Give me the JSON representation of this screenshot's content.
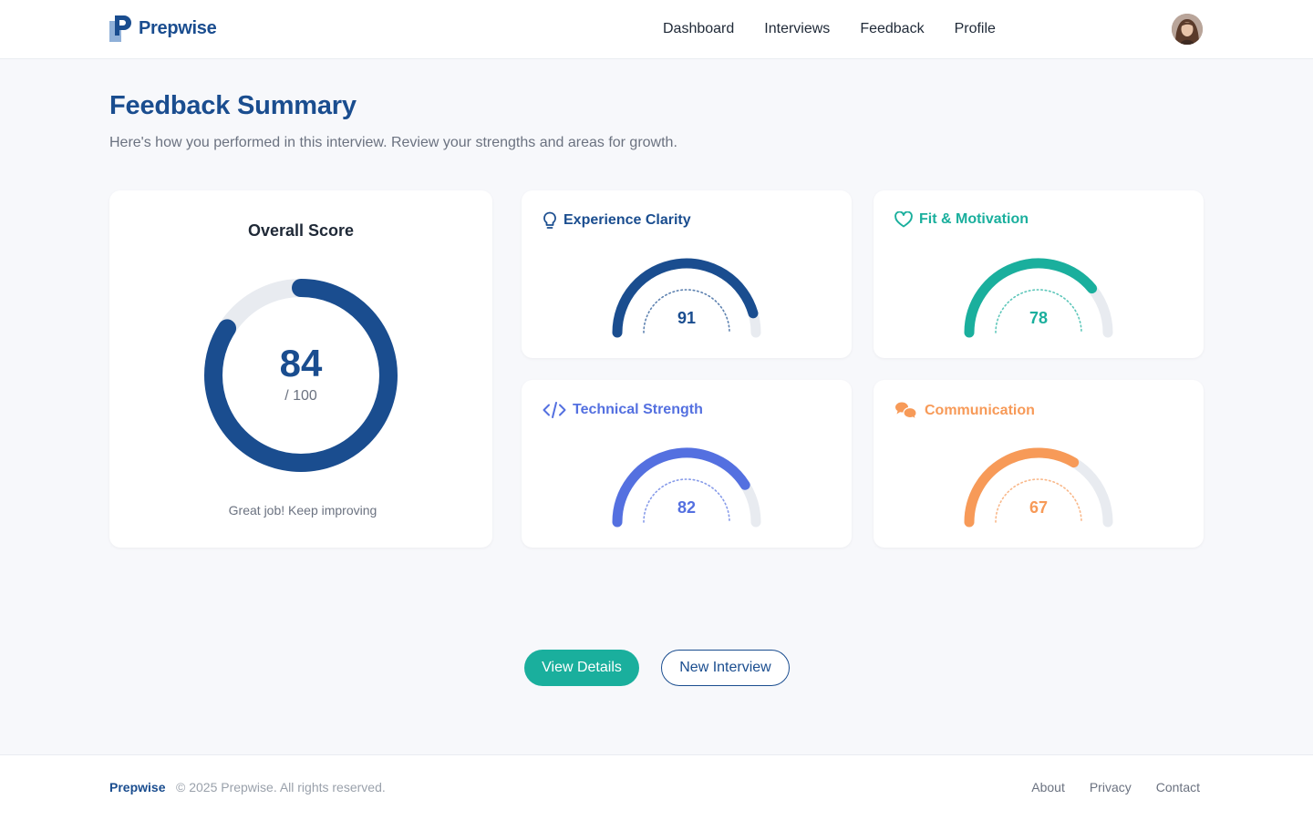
{
  "brand": {
    "name": "Prepwise"
  },
  "nav": {
    "items": [
      {
        "label": "Dashboard"
      },
      {
        "label": "Interviews"
      },
      {
        "label": "Feedback"
      },
      {
        "label": "Profile"
      }
    ]
  },
  "page": {
    "title": "Feedback Summary",
    "subtitle": "Here's how you performed in this interview. Review your strengths and areas for growth."
  },
  "overall": {
    "title": "Overall Score",
    "score": "84",
    "max": "/ 100",
    "caption": "Great job! Keep improving",
    "color": "#1a4d8f",
    "track_color": "#e8ebf0",
    "fraction": 0.84
  },
  "metrics": [
    {
      "label": "Experience Clarity",
      "value": "91",
      "fraction": 0.91,
      "color": "#1a4d8f",
      "icon": "lightbulb-icon"
    },
    {
      "label": "Fit & Motivation",
      "value": "78",
      "fraction": 0.78,
      "color": "#1aaf9d",
      "icon": "heart-icon"
    },
    {
      "label": "Technical Strength",
      "value": "82",
      "fraction": 0.82,
      "color": "#5470e0",
      "icon": "code-icon"
    },
    {
      "label": "Communication",
      "value": "67",
      "fraction": 0.67,
      "color": "#f79a58",
      "icon": "chat-bubbles-icon"
    }
  ],
  "actions": {
    "view_details": "View Details",
    "new_interview": "New Interview"
  },
  "footer": {
    "brand": "Prepwise",
    "copyright": "© 2025 Prepwise. All rights reserved.",
    "links": [
      {
        "label": "About"
      },
      {
        "label": "Privacy"
      },
      {
        "label": "Contact"
      }
    ]
  }
}
